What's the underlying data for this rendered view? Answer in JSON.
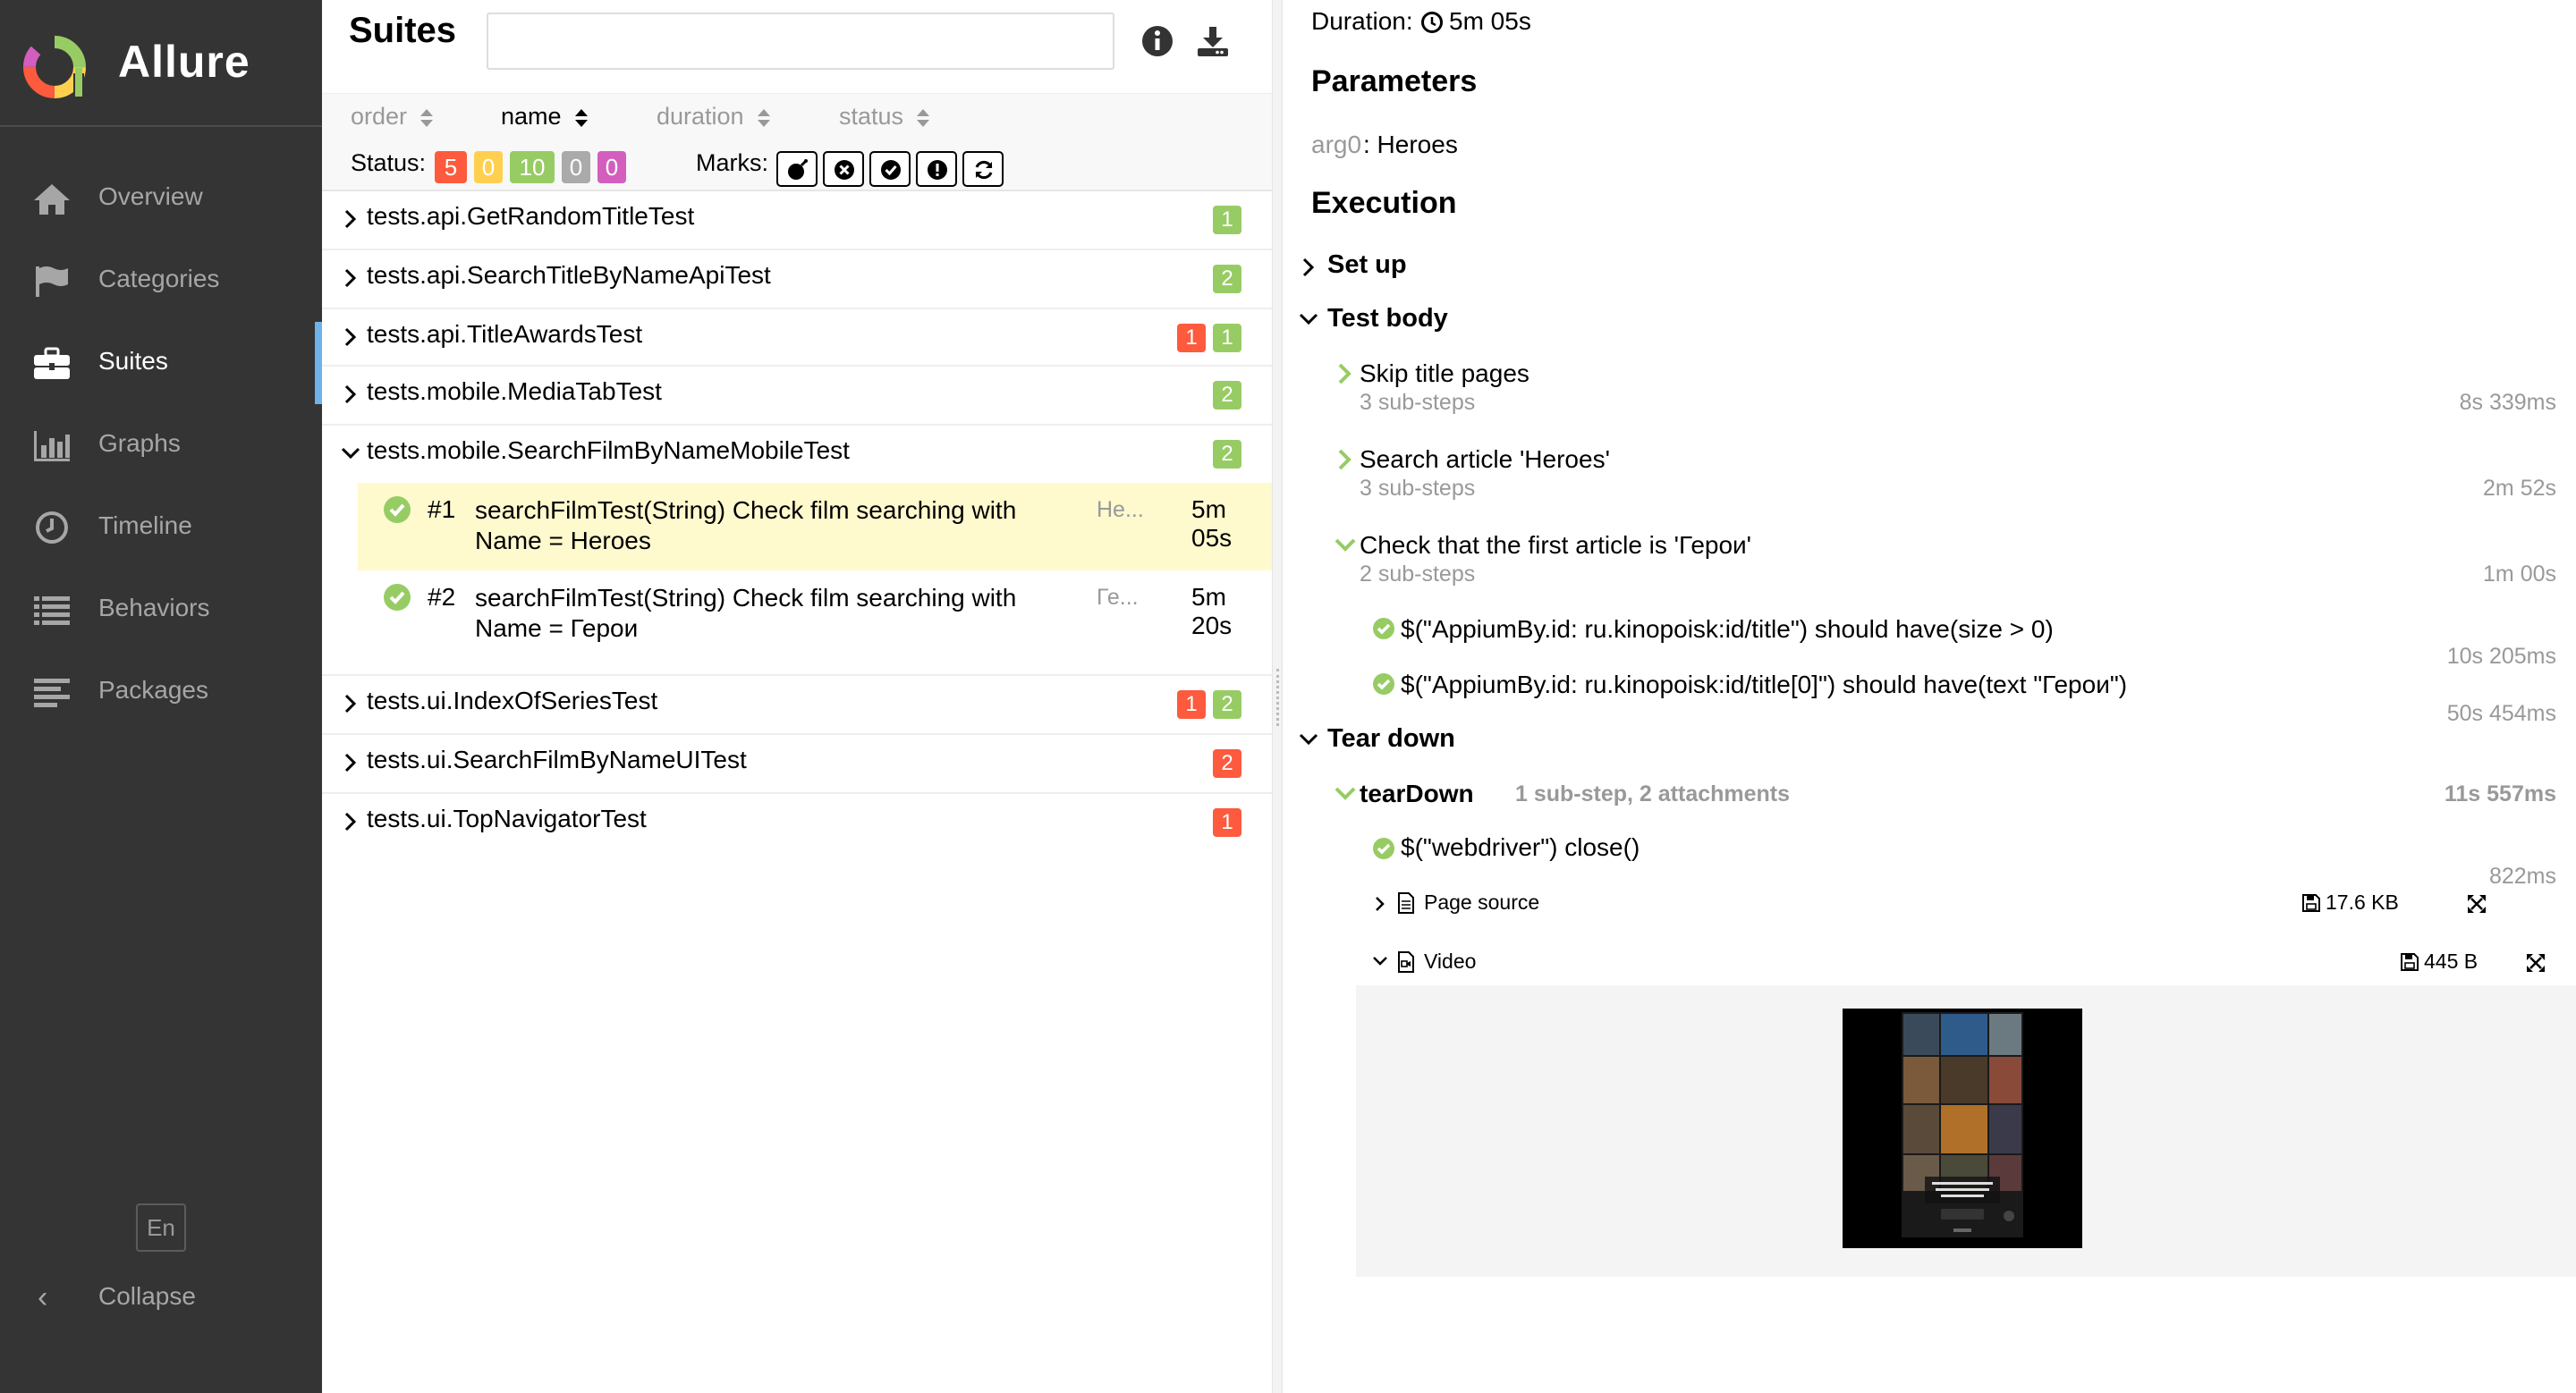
{
  "app": {
    "name": "Allure"
  },
  "sidebar": {
    "items": [
      {
        "label": "Overview",
        "icon": "home-icon",
        "active": false
      },
      {
        "label": "Categories",
        "icon": "flag-icon",
        "active": false
      },
      {
        "label": "Suites",
        "icon": "briefcase-icon",
        "active": true
      },
      {
        "label": "Graphs",
        "icon": "bar-chart-icon",
        "active": false
      },
      {
        "label": "Timeline",
        "icon": "clock-icon",
        "active": false
      },
      {
        "label": "Behaviors",
        "icon": "list-icon",
        "active": false
      },
      {
        "label": "Packages",
        "icon": "align-left-icon",
        "active": false
      }
    ],
    "language": "En",
    "collapse_label": "Collapse"
  },
  "suites": {
    "title": "Suites",
    "search": {
      "value": "",
      "placeholder": ""
    },
    "sort": {
      "order": "order",
      "name": "name",
      "duration": "duration",
      "status": "status"
    },
    "status_label": "Status:",
    "status_counts": {
      "failed": "5",
      "broken": "0",
      "passed": "10",
      "skipped": "0",
      "unknown": "0"
    },
    "marks_label": "Marks:",
    "tree": [
      {
        "name": "tests.api.GetRandomTitleTest",
        "expanded": false,
        "counts": [
          {
            "value": "1",
            "status": "passed"
          }
        ]
      },
      {
        "name": "tests.api.SearchTitleByNameApiTest",
        "expanded": false,
        "counts": [
          {
            "value": "2",
            "status": "passed"
          }
        ]
      },
      {
        "name": "tests.api.TitleAwardsTest",
        "expanded": false,
        "counts": [
          {
            "value": "1",
            "status": "failed"
          },
          {
            "value": "1",
            "status": "passed"
          }
        ]
      },
      {
        "name": "tests.mobile.MediaTabTest",
        "expanded": false,
        "counts": [
          {
            "value": "2",
            "status": "passed"
          }
        ]
      },
      {
        "name": "tests.mobile.SearchFilmByNameMobileTest",
        "expanded": true,
        "counts": [
          {
            "value": "2",
            "status": "passed"
          }
        ]
      },
      {
        "name": "tests.ui.IndexOfSeriesTest",
        "expanded": false,
        "counts": [
          {
            "value": "1",
            "status": "failed"
          },
          {
            "value": "2",
            "status": "passed"
          }
        ]
      },
      {
        "name": "tests.ui.SearchFilmByNameUITest",
        "expanded": false,
        "counts": [
          {
            "value": "2",
            "status": "failed"
          }
        ]
      },
      {
        "name": "tests.ui.TopNavigatorTest",
        "expanded": false,
        "counts": [
          {
            "value": "1",
            "status": "failed"
          }
        ]
      }
    ],
    "tests": [
      {
        "num": "#1",
        "name": "searchFilmTest(String) Check film searching with Name = Heroes",
        "param": "He...",
        "duration": "5m 05s",
        "selected": true
      },
      {
        "num": "#2",
        "name": "searchFilmTest(String) Check film searching with Name = Герои",
        "param": "Ге...",
        "duration": "5m 20s",
        "selected": false
      }
    ]
  },
  "detail": {
    "duration_label": "Duration:",
    "duration": "5m 05s",
    "parameters_title": "Parameters",
    "param_name": "arg0",
    "param_value": ": Heroes",
    "execution_title": "Execution",
    "setup_label": "Set up",
    "test_body_label": "Test body",
    "steps": [
      {
        "name": "Skip title pages",
        "sub": "3 sub-steps",
        "time": "8s 339ms"
      },
      {
        "name": "Search article 'Heroes'",
        "sub": "3 sub-steps",
        "time": "2m 52s"
      },
      {
        "name": "Check that the first article is 'Герои'",
        "sub": "2 sub-steps",
        "time": "1m 00s"
      }
    ],
    "substeps": [
      {
        "name": "$(\"AppiumBy.id: ru.kinopoisk:id/title\") should have(size > 0)",
        "time": "10s 205ms"
      },
      {
        "name": "$(\"AppiumBy.id: ru.kinopoisk:id/title[0]\") should have(text \"Герои\")",
        "time": "50s 454ms"
      }
    ],
    "teardown_label": "Tear down",
    "teardown": {
      "name": "tearDown",
      "info": "1 sub-step, 2 attachments",
      "time": "11s 557ms"
    },
    "close_step": {
      "name": "$(\"webdriver\") close()",
      "time": "822ms"
    },
    "attachments": [
      {
        "name": "Page source",
        "size": "17.6 KB",
        "icon": "file-text-icon",
        "expanded": false
      },
      {
        "name": "Video",
        "size": "445 B",
        "icon": "file-video-icon",
        "expanded": true
      }
    ]
  }
}
